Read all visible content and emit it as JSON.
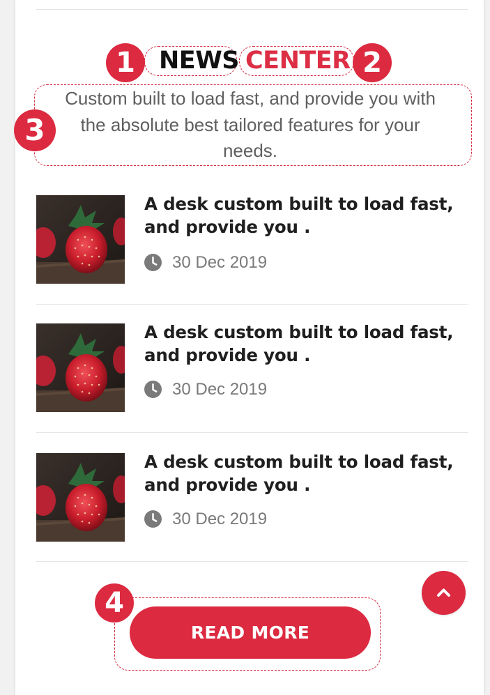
{
  "section": {
    "title_part1": "NEWS",
    "title_part2": "CENTER",
    "subtitle": "Custom built to load fast, and provide you with the absolute best tailored features for your needs."
  },
  "annotations": {
    "badge_1": "1",
    "badge_2": "2",
    "badge_3": "3",
    "badge_4": "4"
  },
  "news": [
    {
      "title": "A desk custom built to load fast, and provide you .",
      "date": "30 Dec 2019",
      "icon": "clock-icon"
    },
    {
      "title": "A desk custom built to load fast, and provide you .",
      "date": "30 Dec 2019",
      "icon": "clock-icon"
    },
    {
      "title": "A desk custom built to load fast, and provide you .",
      "date": "30 Dec 2019",
      "icon": "clock-icon"
    }
  ],
  "buttons": {
    "read_more": "READ MORE",
    "scroll_top_icon": "chevron-up-icon"
  },
  "colors": {
    "accent": "#dc2a40",
    "title_dark": "#111111",
    "text_gray": "#5f5f5f",
    "date_gray": "#7a7a7a"
  }
}
